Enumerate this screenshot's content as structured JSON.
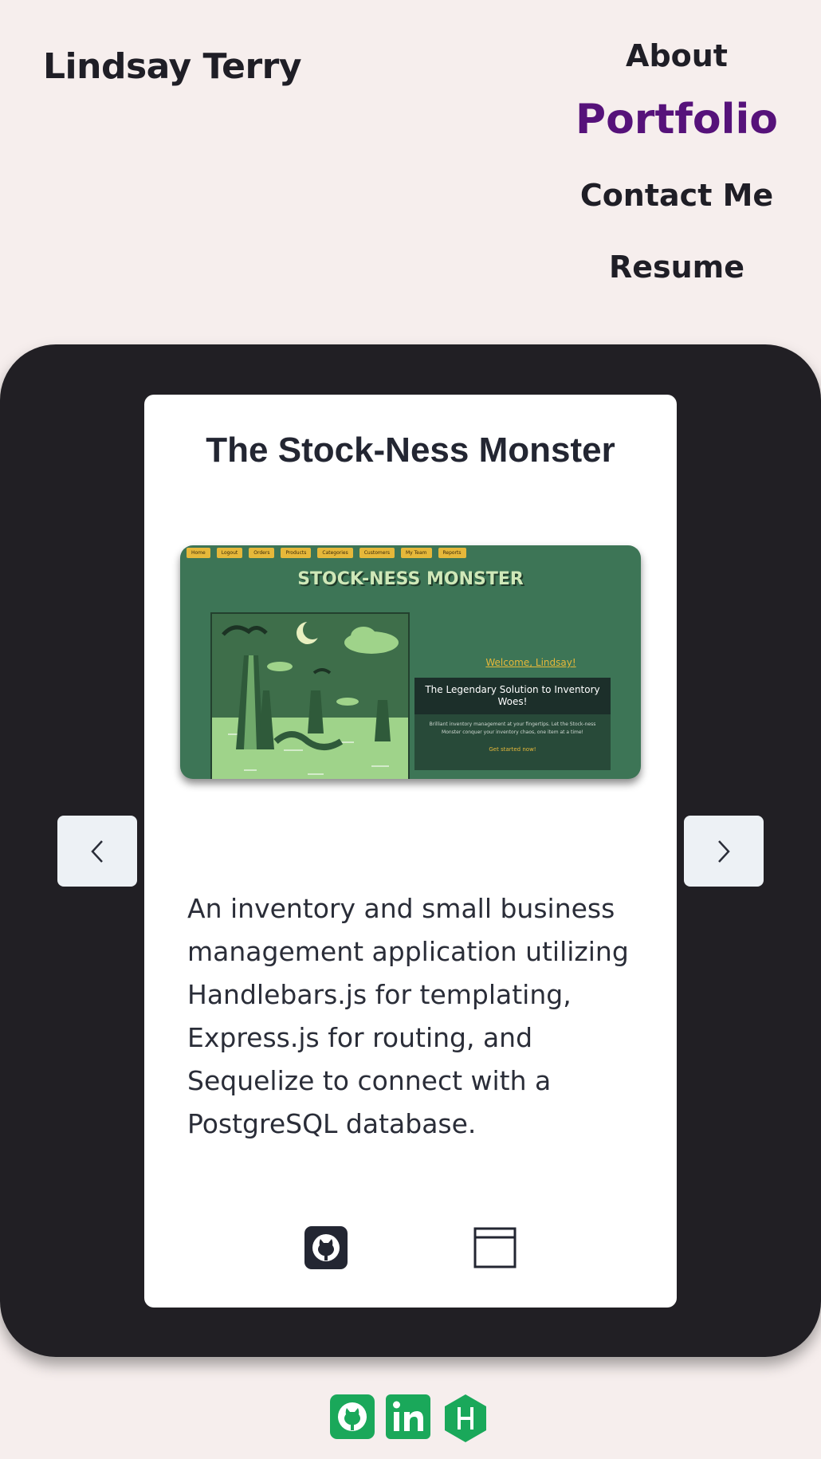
{
  "header": {
    "brand": "Lindsay Terry",
    "nav": [
      {
        "label": "About",
        "active": false
      },
      {
        "label": "Portfolio",
        "active": true
      },
      {
        "label": "Contact Me",
        "active": false
      },
      {
        "label": "Resume",
        "active": false
      }
    ]
  },
  "project": {
    "title": "The Stock-Ness Monster",
    "description": "An inventory and small business management application utilizing Handlebars.js for templating, Express.js for routing, and Sequelize to connect with a PostgreSQL database.",
    "screenshot": {
      "nav_items": [
        "Home",
        "Logout",
        "Orders",
        "Products",
        "Categories",
        "Customers",
        "My Team",
        "Reports"
      ],
      "logo_text": "STOCK-NESS MONSTER",
      "welcome": "Welcome, Lindsay!",
      "panel_heading": "The Legendary Solution to Inventory Woes!",
      "panel_body": "Brilliant inventory management at your fingertips. Let the Stock-ness Monster conquer your inventory chaos, one item at a time!",
      "panel_cta": "Get started now!"
    },
    "links": {
      "github_icon": "github-icon",
      "deployed_icon": "browser-window-icon"
    }
  },
  "carousel": {
    "prev_icon": "chevron-left-icon",
    "next_icon": "chevron-right-icon"
  },
  "footer": {
    "icons": [
      "github-icon",
      "linkedin-icon",
      "hackerrank-icon"
    ]
  },
  "colors": {
    "background": "#f6eeed",
    "stage": "#211f24",
    "accent": "#56127a",
    "text_dark": "#1f1e26",
    "footer_icon": "#1aa85a",
    "screenshot_bg": "#3d7556"
  }
}
